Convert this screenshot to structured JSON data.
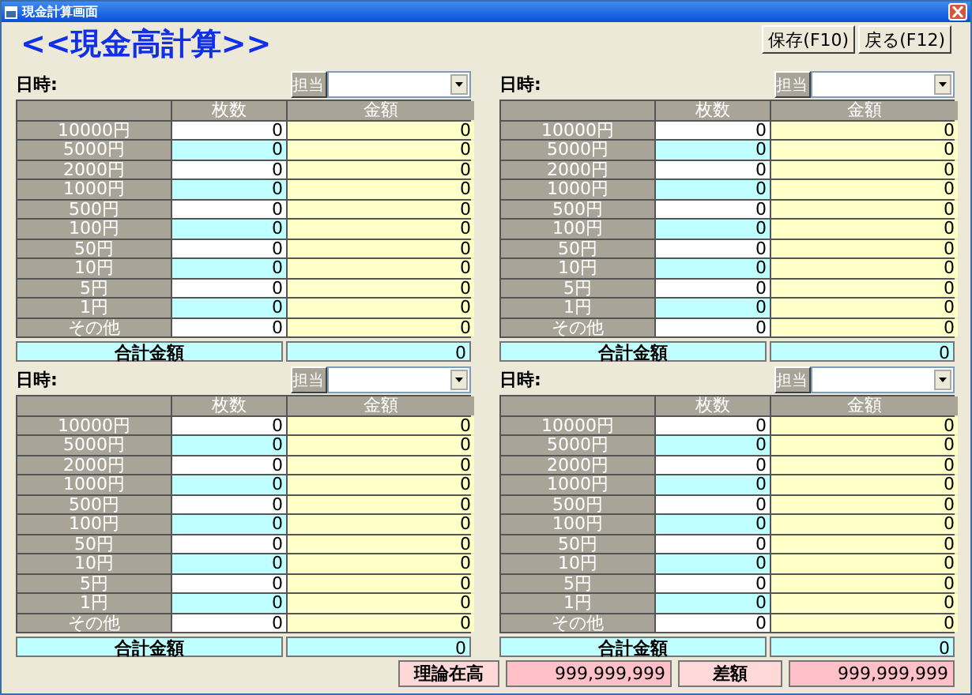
{
  "window": {
    "title": "現金計算画面"
  },
  "heading": "<<現金高計算>>",
  "buttons": [
    "保存(F10)",
    "戻る(F12)"
  ],
  "panels": [
    {
      "date_label": "日時:",
      "staff_button": "担当",
      "columns": [
        "枚数",
        "金額"
      ],
      "rows": [
        {
          "denomination": "10000円",
          "count": "0",
          "amount": "0"
        },
        {
          "denomination": "5000円",
          "count": "0",
          "amount": "0"
        },
        {
          "denomination": "2000円",
          "count": "0",
          "amount": "0"
        },
        {
          "denomination": "1000円",
          "count": "0",
          "amount": "0"
        },
        {
          "denomination": "500円",
          "count": "0",
          "amount": "0"
        },
        {
          "denomination": "100円",
          "count": "0",
          "amount": "0"
        },
        {
          "denomination": "50円",
          "count": "0",
          "amount": "0"
        },
        {
          "denomination": "10円",
          "count": "0",
          "amount": "0"
        },
        {
          "denomination": "5円",
          "count": "0",
          "amount": "0"
        },
        {
          "denomination": "1円",
          "count": "0",
          "amount": "0"
        },
        {
          "denomination": "その他",
          "count": "0",
          "amount": "0"
        }
      ],
      "total_label": "合計金額",
      "total_value": "0"
    },
    {
      "date_label": "日時:",
      "staff_button": "担当",
      "columns": [
        "枚数",
        "金額"
      ],
      "rows": [
        {
          "denomination": "10000円",
          "count": "0",
          "amount": "0"
        },
        {
          "denomination": "5000円",
          "count": "0",
          "amount": "0"
        },
        {
          "denomination": "2000円",
          "count": "0",
          "amount": "0"
        },
        {
          "denomination": "1000円",
          "count": "0",
          "amount": "0"
        },
        {
          "denomination": "500円",
          "count": "0",
          "amount": "0"
        },
        {
          "denomination": "100円",
          "count": "0",
          "amount": "0"
        },
        {
          "denomination": "50円",
          "count": "0",
          "amount": "0"
        },
        {
          "denomination": "10円",
          "count": "0",
          "amount": "0"
        },
        {
          "denomination": "5円",
          "count": "0",
          "amount": "0"
        },
        {
          "denomination": "1円",
          "count": "0",
          "amount": "0"
        },
        {
          "denomination": "その他",
          "count": "0",
          "amount": "0"
        }
      ],
      "total_label": "合計金額",
      "total_value": "0"
    },
    {
      "date_label": "日時:",
      "staff_button": "担当",
      "columns": [
        "枚数",
        "金額"
      ],
      "rows": [
        {
          "denomination": "10000円",
          "count": "0",
          "amount": "0"
        },
        {
          "denomination": "5000円",
          "count": "0",
          "amount": "0"
        },
        {
          "denomination": "2000円",
          "count": "0",
          "amount": "0"
        },
        {
          "denomination": "1000円",
          "count": "0",
          "amount": "0"
        },
        {
          "denomination": "500円",
          "count": "0",
          "amount": "0"
        },
        {
          "denomination": "100円",
          "count": "0",
          "amount": "0"
        },
        {
          "denomination": "50円",
          "count": "0",
          "amount": "0"
        },
        {
          "denomination": "10円",
          "count": "0",
          "amount": "0"
        },
        {
          "denomination": "5円",
          "count": "0",
          "amount": "0"
        },
        {
          "denomination": "1円",
          "count": "0",
          "amount": "0"
        },
        {
          "denomination": "その他",
          "count": "0",
          "amount": "0"
        }
      ],
      "total_label": "合計金額",
      "total_value": "0"
    },
    {
      "date_label": "日時:",
      "staff_button": "担当",
      "columns": [
        "枚数",
        "金額"
      ],
      "rows": [
        {
          "denomination": "10000円",
          "count": "0",
          "amount": "0"
        },
        {
          "denomination": "5000円",
          "count": "0",
          "amount": "0"
        },
        {
          "denomination": "2000円",
          "count": "0",
          "amount": "0"
        },
        {
          "denomination": "1000円",
          "count": "0",
          "amount": "0"
        },
        {
          "denomination": "500円",
          "count": "0",
          "amount": "0"
        },
        {
          "denomination": "100円",
          "count": "0",
          "amount": "0"
        },
        {
          "denomination": "50円",
          "count": "0",
          "amount": "0"
        },
        {
          "denomination": "10円",
          "count": "0",
          "amount": "0"
        },
        {
          "denomination": "5円",
          "count": "0",
          "amount": "0"
        },
        {
          "denomination": "1円",
          "count": "0",
          "amount": "0"
        },
        {
          "denomination": "その他",
          "count": "0",
          "amount": "0"
        }
      ],
      "total_label": "合計金額",
      "total_value": "0"
    }
  ],
  "footer": [
    {
      "label": "理論在高",
      "value": "999,999,999"
    },
    {
      "label": "差額",
      "value": "999,999,999"
    }
  ]
}
